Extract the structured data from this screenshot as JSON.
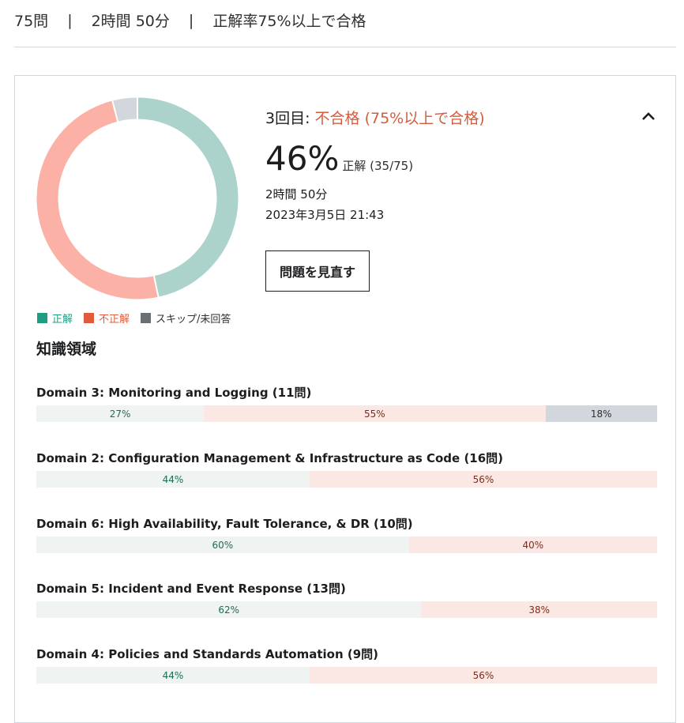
{
  "summary": {
    "questions": "75問",
    "separator": "|",
    "duration": "2時間 50分",
    "pass_rule": "正解率75%以上で合格"
  },
  "result": {
    "attempt_label": "3回目:",
    "status": "不合格 (75%以上で合格)",
    "percent": "46%",
    "correct_label": "正解 (35/75)",
    "duration": "2時間 50分",
    "datetime": "2023年3月5日 21:43",
    "review_button": "問題を見直す"
  },
  "donut": {
    "correct": 35,
    "incorrect": 37,
    "skipped": 3,
    "colors": {
      "correct": "#acd2cc",
      "incorrect": "#fbb1a5",
      "skipped": "#d1d7dc"
    }
  },
  "legend": [
    {
      "label": "正解",
      "color": "#1e9d80",
      "text_color": "#1e9d80"
    },
    {
      "label": "不正解",
      "color": "#e15b3b",
      "text_color": "#e15b3b"
    },
    {
      "label": "スキップ/未回答",
      "color": "#6a6f73",
      "text_color": "#2d2f31"
    }
  ],
  "knowledge": {
    "title": "知識領域",
    "domains": [
      {
        "name": "Domain 3: Monitoring and Logging (11問)",
        "correct": 27,
        "incorrect": 55,
        "skipped": 18,
        "correct_label": "27%",
        "incorrect_label": "55%",
        "skipped_label": "18%"
      },
      {
        "name": "Domain 2: Configuration Management & Infrastructure as Code (16問)",
        "correct": 44,
        "incorrect": 56,
        "skipped": 0,
        "correct_label": "44%",
        "incorrect_label": "56%",
        "skipped_label": ""
      },
      {
        "name": "Domain 6: High Availability, Fault Tolerance, & DR (10問)",
        "correct": 60,
        "incorrect": 40,
        "skipped": 0,
        "correct_label": "60%",
        "incorrect_label": "40%",
        "skipped_label": ""
      },
      {
        "name": "Domain 5: Incident and Event Response (13問)",
        "correct": 62,
        "incorrect": 38,
        "skipped": 0,
        "correct_label": "62%",
        "incorrect_label": "38%",
        "skipped_label": ""
      },
      {
        "name": "Domain 4: Policies and Standards Automation (9問)",
        "correct": 44,
        "incorrect": 56,
        "skipped": 0,
        "correct_label": "44%",
        "incorrect_label": "56%",
        "skipped_label": ""
      }
    ]
  },
  "icons": {
    "collapse": "chevron-up-icon"
  }
}
